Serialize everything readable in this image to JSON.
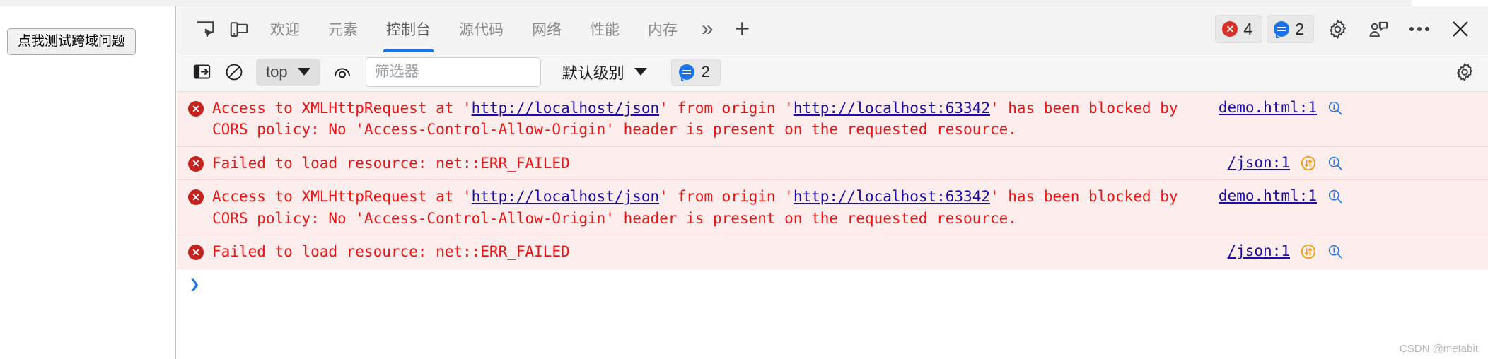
{
  "page": {
    "button_label": "点我测试跨域问题"
  },
  "devtools": {
    "tabs": [
      {
        "label": "欢迎",
        "active": false
      },
      {
        "label": "元素",
        "active": false
      },
      {
        "label": "控制台",
        "active": true
      },
      {
        "label": "源代码",
        "active": false
      },
      {
        "label": "网络",
        "active": false
      },
      {
        "label": "性能",
        "active": false
      },
      {
        "label": "内存",
        "active": false
      }
    ],
    "more_tabs_glyph": "»",
    "add_tab_glyph": "+",
    "error_count": "4",
    "warning_count": "2",
    "icons": {
      "inspect": "inspect-element-icon",
      "device": "device-toolbar-icon",
      "settings": "gear-icon",
      "feedback": "feedback-icon",
      "more": "more-options-icon",
      "close": "close-icon"
    }
  },
  "filterbar": {
    "sidebar_toggle": "console-sidebar-icon",
    "clear_console": "clear-console-icon",
    "context_label": "top",
    "eye_icon": "live-expression-icon",
    "filter_placeholder": "筛选器",
    "filter_value": "",
    "level_label": "默认级别",
    "info_count": "2",
    "settings_icon": "gear-icon"
  },
  "console": {
    "messages": [
      {
        "type": "error",
        "segments": [
          {
            "t": "text",
            "v": "Access to XMLHttpRequest at '"
          },
          {
            "t": "link",
            "v": "http://localhost/json"
          },
          {
            "t": "text",
            "v": "' from origin '"
          },
          {
            "t": "link",
            "v": "http://localhost:63342"
          },
          {
            "t": "text",
            "v": "' has been blocked by CORS policy: No 'Access-Control-Allow-Origin' header is present on the requested resource."
          }
        ],
        "source": "demo.html:1",
        "has_network_icon": false,
        "has_zoom_icon": true
      },
      {
        "type": "error",
        "segments": [
          {
            "t": "text",
            "v": "Failed to load resource: net::ERR_FAILED"
          }
        ],
        "source": "/json:1",
        "has_network_icon": true,
        "has_zoom_icon": true
      },
      {
        "type": "error",
        "segments": [
          {
            "t": "text",
            "v": "Access to XMLHttpRequest at '"
          },
          {
            "t": "link",
            "v": "http://localhost/json"
          },
          {
            "t": "text",
            "v": "' from origin '"
          },
          {
            "t": "link",
            "v": "http://localhost:63342"
          },
          {
            "t": "text",
            "v": "' has been blocked by CORS policy: No 'Access-Control-Allow-Origin' header is present on the requested resource."
          }
        ],
        "source": "demo.html:1",
        "has_network_icon": false,
        "has_zoom_icon": true
      },
      {
        "type": "error",
        "segments": [
          {
            "t": "text",
            "v": "Failed to load resource: net::ERR_FAILED"
          }
        ],
        "source": "/json:1",
        "has_network_icon": true,
        "has_zoom_icon": true
      }
    ],
    "prompt_glyph": "❯"
  },
  "watermark": "CSDN @metabit",
  "colors": {
    "error_text": "#ef1313",
    "error_bg": "#fdeded",
    "link": "#1a0dab",
    "accent": "#1a73e8",
    "error_badge": "#d93025",
    "network_icon": "#f29900"
  }
}
